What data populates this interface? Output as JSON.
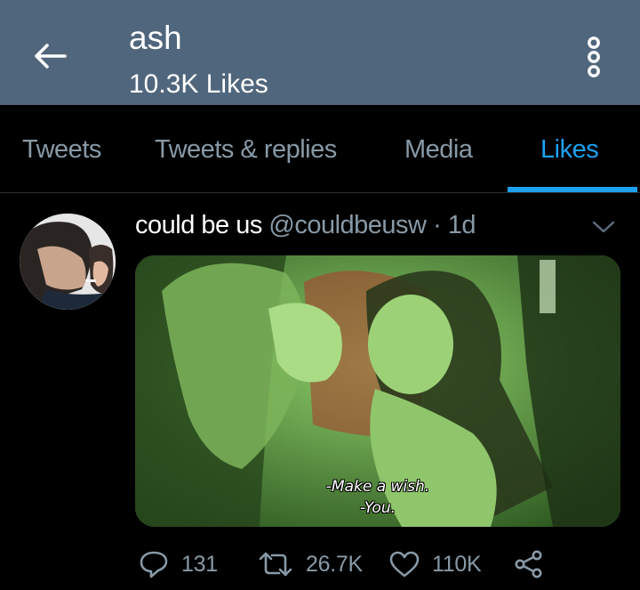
{
  "header": {
    "title": "ash",
    "subtitle": "10.3K Likes",
    "back_icon": "arrow-left-icon",
    "more_icon": "more-vertical-icon",
    "background": "#50667c"
  },
  "tabs": [
    {
      "label": "Tweets",
      "active": false
    },
    {
      "label": "Tweets & replies",
      "active": false
    },
    {
      "label": "Media",
      "active": false
    },
    {
      "label": "Likes",
      "active": true
    }
  ],
  "tweet": {
    "author_name": "could be us",
    "author_handle": "@couldbeusw",
    "separator": "·",
    "time": "1d",
    "media": {
      "subtitle_line1": "-Make a wish.",
      "subtitle_line2": "-You."
    },
    "actions": {
      "replies": "131",
      "retweets": "26.7K",
      "likes": "110K"
    }
  },
  "colors": {
    "accent": "#1da1f2",
    "muted": "#8899a6",
    "background": "#000000"
  }
}
